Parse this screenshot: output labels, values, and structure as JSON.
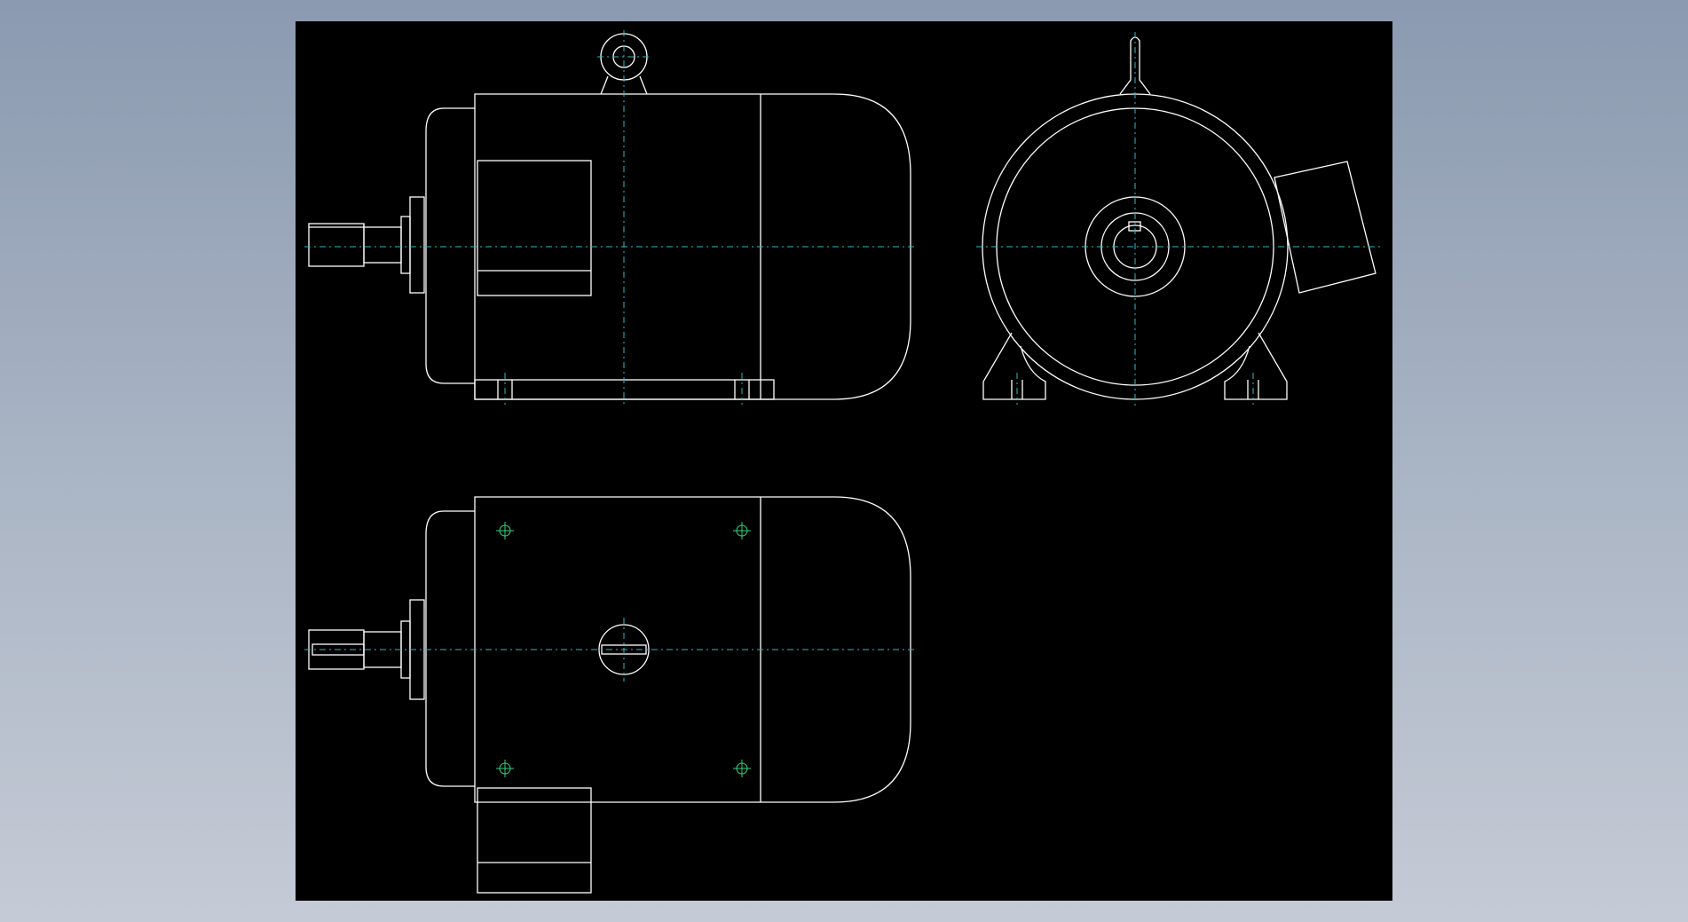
{
  "window": {
    "background_top": "#8b9ab0",
    "background_bottom": "#c5cbd6"
  },
  "drawing": {
    "sheet_color": "#000000",
    "line_color": "#ffffff",
    "centerline_color": "#2fb8c8",
    "marker_color": "#35d27a",
    "views": [
      "front-view",
      "end-view",
      "top-view"
    ]
  }
}
